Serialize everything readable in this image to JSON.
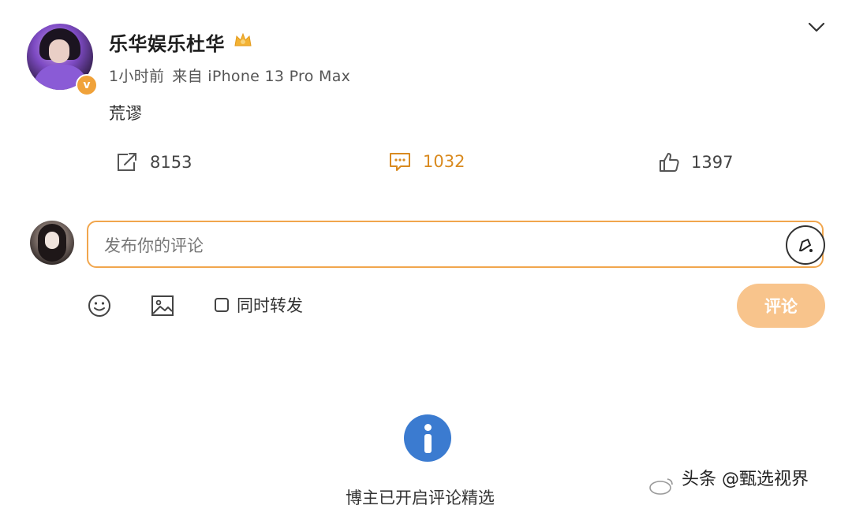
{
  "post": {
    "author": "乐华娱乐杜华",
    "time_ago": "1小时前",
    "source": "来自 iPhone 13 Pro Max",
    "text": "荒谬"
  },
  "actions": {
    "repost_count": "8153",
    "comment_count": "1032",
    "like_count": "1397"
  },
  "composer": {
    "placeholder": "发布你的评论",
    "repost_label": "同时转发",
    "submit_label": "评论"
  },
  "notice": {
    "text": "博主已开启评论精选"
  },
  "watermark": {
    "text": "头条 @甄选视界"
  },
  "colors": {
    "accent": "#f1a64d",
    "comment_active": "#d98a1f",
    "submit_disabled": "#f8c48c",
    "info_blue": "#3b7bd0"
  }
}
